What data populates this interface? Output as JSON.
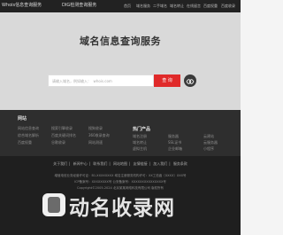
{
  "topnav": {
    "brand": "Whois信息查询服务",
    "brand2": "DIG检测查询服务",
    "items": [
      "首页",
      "域名服务",
      "二手域名",
      "域名转让",
      "在线留言",
      "百度权重",
      "百度收录"
    ]
  },
  "hero": {
    "title": "域名信息查询服务",
    "search": {
      "placeholder": "请输入域名，例如输入：  whois.com",
      "button": "查 询"
    }
  },
  "links": {
    "col1": {
      "title": "网站",
      "items": [
        "网站信息查询",
        "综合域名解析",
        "百度权重"
      ]
    },
    "col2": {
      "items": [
        "搜索引擎收录",
        "百度关键词排名",
        "谷歌收录"
      ]
    },
    "col3": {
      "items": [
        "搜狗收录",
        "360收录查询",
        "网站测速"
      ]
    },
    "col4": {
      "title": "热门产品",
      "items": [
        "域名注册",
        "域名转让",
        "虚拟主机"
      ]
    },
    "col5": {
      "items": [
        "服务器",
        "SSL证书",
        "企业邮箱"
      ]
    },
    "col6": {
      "items": [
        "云建站",
        "云服务器",
        "小程序"
      ]
    }
  },
  "footer": {
    "links": [
      "关于我们",
      "新闻中心",
      "联系我们",
      "网站地图",
      "友情链接",
      "加入我们",
      "服务条款"
    ],
    "line1": "增值电信业务经营许可证：B1-XXXXXXXX  域名注册服务机构许可：XX工信函〔XXXX〕XXX号",
    "line2": "ICP备案号：XXXXXXXX号  公安备案号：XXXXXXXXXXXXXXX号",
    "line3": "Copyright©2005-2024 北京某某网络科技有限公司 版权所有"
  },
  "watermark": "动名收录网"
}
